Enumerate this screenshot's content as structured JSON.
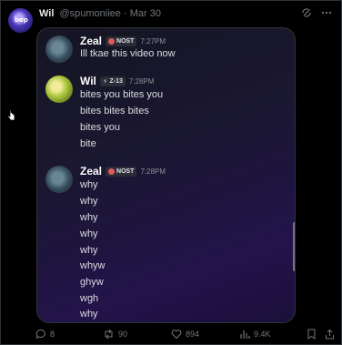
{
  "tweet": {
    "author_name": "Wil",
    "handle": "@spumoniiee",
    "separator": "·",
    "date": "Mar 30",
    "avatar_text": "bɐp"
  },
  "media": {
    "messages": [
      {
        "user": "Zeal",
        "tag": "NOST",
        "time": "7:27PM",
        "lines": [
          "Ill tkae this video now"
        ]
      },
      {
        "user": "Wil",
        "tag": "Z-13",
        "time": "7:28PM",
        "lines": [
          "bites you bites you",
          "bites bites bites",
          "bites you",
          "bite"
        ]
      },
      {
        "user": "Zeal",
        "tag": "NOST",
        "time": "7:28PM",
        "lines": [
          "why",
          "why",
          "why",
          "why",
          "why",
          "whyw",
          "ghyw",
          "wgh",
          "why"
        ]
      }
    ]
  },
  "actions": {
    "replies": "8",
    "reposts": "90",
    "likes": "894",
    "views": "9.4K"
  },
  "icons": {
    "grok": "grok-icon",
    "more": "more-icon",
    "reply": "reply-icon",
    "repost": "repost-icon",
    "like": "heart-icon",
    "views": "views-icon",
    "bookmark": "bookmark-icon",
    "share": "share-icon"
  },
  "colors": {
    "background": "#000000",
    "border": "#2f3336",
    "muted": "#71767b",
    "tag_red": "#e05a5a"
  }
}
